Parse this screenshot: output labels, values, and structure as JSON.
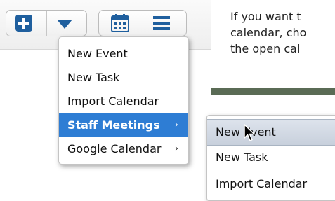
{
  "toolbar": {
    "add_icon": "plus-icon",
    "dropdown_icon": "caret-down-icon",
    "calendar_icon": "calendar-icon",
    "list_icon": "hamburger-icon",
    "accent": "#2e7dd4"
  },
  "help_text": {
    "line1": "If you want t",
    "line2": "calendar, cho",
    "line3": "the open cal"
  },
  "main_menu": {
    "items": [
      {
        "label": "New Event"
      },
      {
        "label": "New Task"
      },
      {
        "label": "Import Calendar"
      },
      {
        "label": "Staff Meetings",
        "arrow": "›",
        "selected": true
      },
      {
        "label": "Google Calendar",
        "arrow": "›"
      }
    ]
  },
  "sub_menu": {
    "items": [
      {
        "label": "New Event",
        "hover": true
      },
      {
        "label": "New Task"
      },
      {
        "label": "Import Calendar"
      }
    ]
  }
}
